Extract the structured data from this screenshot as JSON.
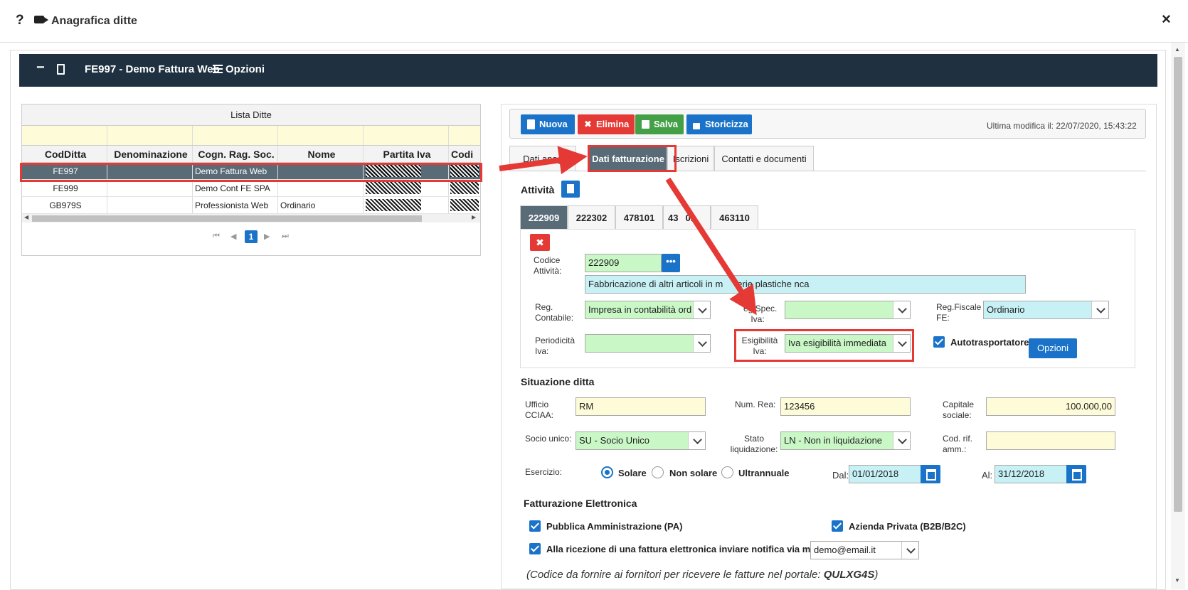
{
  "window": {
    "help": "?",
    "title": "Anagrafica ditte",
    "close": "×"
  },
  "navbar": {
    "minus": "−",
    "company": "FE997 - Demo Fattura Web",
    "options": "Opzioni"
  },
  "grid": {
    "caption": "Lista Ditte",
    "columns": [
      "CodDitta",
      "Denominazione",
      "Cogn. Rag. Soc.",
      "Nome",
      "Partita Iva",
      "Codi"
    ],
    "rows": [
      {
        "cod": "FE997",
        "denom": "",
        "cogn": "Demo Fattura Web",
        "nome": ""
      },
      {
        "cod": "FE999",
        "denom": "",
        "cogn": "Demo Cont FE SPA",
        "nome": ""
      },
      {
        "cod": "GB979S",
        "denom": "",
        "cogn": "Professionista Web",
        "nome": "Ordinario"
      }
    ],
    "pager": {
      "first": "⏮",
      "prev": "◀",
      "page": "1",
      "next": "▶",
      "last": "⏭"
    }
  },
  "toolbar": {
    "new": "Nuova",
    "delete": "Elimina",
    "save": "Salva",
    "history": "Storicizza",
    "last_modified": "Ultima modifica il: 22/07/2020, 15:43:22"
  },
  "tabs": [
    "Dati anag",
    "Dati fatturazione",
    "Iscrizioni",
    "Contatti e documenti"
  ],
  "attivita": {
    "title": "Attività",
    "codes": [
      "222909",
      "222302",
      "478101",
      "43",
      "01",
      "463110"
    ],
    "codice_label": "Codice Attività:",
    "codice_value": "222909",
    "descr": "Fabbricazione di altri articoli in materie plastiche nca",
    "descr_a": "Fabbricazione di altri articoli in m",
    "descr_b": "erie plastiche nca",
    "reg_contabile_label": "Reg. Contabile:",
    "reg_contabile": "Impresa in contabilità ord",
    "reg_spec_label": "eg.Spec. Iva:",
    "reg_fiscale_label": "Reg.Fiscale FE:",
    "reg_fiscale": "Ordinario",
    "periodicita_label": "Periodicità Iva:",
    "esigibilita_label": "Esigibilità Iva:",
    "esigibilita": "Iva esigibilità immediata",
    "autotrasportatore": "Autotrasportatore",
    "opzioni": "Opzioni"
  },
  "situazione": {
    "title": "Situazione ditta",
    "ufficio_label": "Ufficio CCIAA:",
    "ufficio": "RM",
    "rea_label": "Num. Rea:",
    "rea": "123456",
    "capitale_label": "Capitale sociale:",
    "capitale": "100.000,00",
    "socio_label": "Socio unico:",
    "socio": "SU - Socio Unico",
    "stato_label": "Stato liquidazione:",
    "stato": "LN - Non in liquidazione",
    "codrif_label": "Cod. rif. amm.:",
    "esercizio_label": "Esercizio:",
    "solare": "Solare",
    "non_solare": "Non solare",
    "ultrannuale": "Ultrannuale",
    "dal_label": "Dal:",
    "dal": "01/01/2018",
    "al_label": "Al:",
    "al": "31/12/2018"
  },
  "fe": {
    "title": "Fatturazione Elettronica",
    "pa": "Pubblica Amministrazione (PA)",
    "b2b": "Azienda Privata (B2B/B2C)",
    "notifica": "Alla ricezione di una fattura elettronica inviare notifica via mail a",
    "email": "demo@email.it",
    "codice_note": "(Codice da fornire ai fornitori per ricevere le fatture nel portale: ",
    "codice": "QULXG4S",
    "codice_end": ")"
  },
  "colors": {
    "navbar": "#1f3140",
    "primary": "#1a73c8",
    "danger": "#e53935",
    "success": "#43a047",
    "highlight": "#e53935"
  }
}
